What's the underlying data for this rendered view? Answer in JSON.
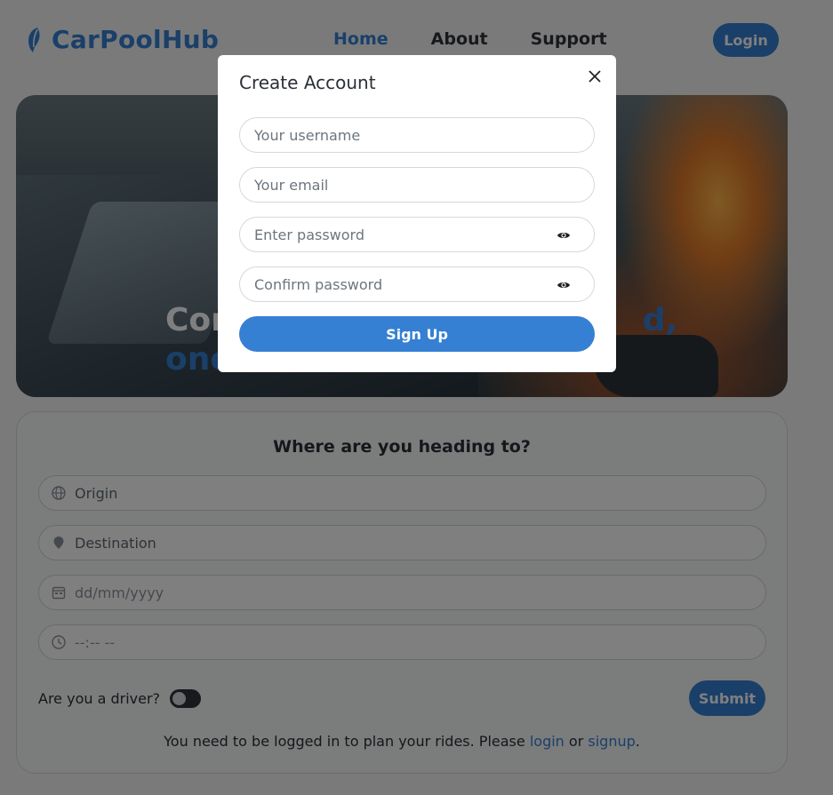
{
  "header": {
    "logo_text": "CarPoolHub",
    "nav": [
      {
        "label": "Home",
        "active": true
      },
      {
        "label": "About",
        "active": false
      },
      {
        "label": "Support",
        "active": false
      }
    ],
    "login_label": "Login"
  },
  "hero": {
    "headline_line1_start": "Con",
    "headline_line1_end": "d,",
    "headline_line2_start": "one"
  },
  "search": {
    "title": "Where are you heading to?",
    "fields": [
      {
        "icon": "globe-icon",
        "placeholder": "Origin"
      },
      {
        "icon": "map-pin-icon",
        "placeholder": "Destination"
      },
      {
        "icon": "calendar-icon",
        "placeholder": "dd/mm/yyyy"
      },
      {
        "icon": "clock-icon",
        "placeholder": "--:-- --"
      }
    ],
    "driver_label": "Are you a driver?",
    "driver_toggle_on": false,
    "submit_label": "Submit",
    "note_prefix": "You need to be logged in to plan your rides. Please",
    "note_login": "login",
    "note_or": "or",
    "note_signup": "signup",
    "note_suffix": "."
  },
  "modal": {
    "title": "Create Account",
    "close_icon": "close-icon",
    "fields": [
      {
        "placeholder": "Your username",
        "has_eye": false
      },
      {
        "placeholder": "Your email",
        "has_eye": false
      },
      {
        "placeholder": "Enter password",
        "has_eye": true
      },
      {
        "placeholder": "Confirm password",
        "has_eye": true
      }
    ],
    "signup_label": "Sign Up"
  },
  "colors": {
    "accent": "#3580d3",
    "overlay": "rgba(0,0,0,0.5)",
    "text": "#2b2f36"
  }
}
